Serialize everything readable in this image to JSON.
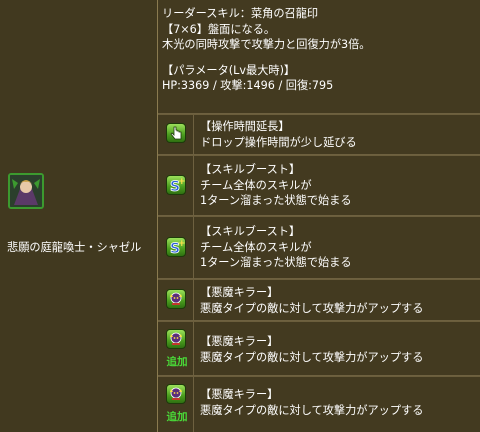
{
  "monster": {
    "name": "悲願の庭龍喚士・シャゼル",
    "portrait_icon": "monster-portrait"
  },
  "leader_skill": {
    "lines": [
      "リーダースキル：菜角の召龍印",
      "【7×6】盤面になる。",
      "木光の同時攻撃で攻撃力と回復力が3倍。"
    ],
    "params_title": "【パラメータ(Lv最大時)】",
    "params": "HP:3369 / 攻撃:1496 / 回復:795"
  },
  "awakenings": [
    {
      "icon": "hand-cursor-icon",
      "title": "【操作時間延長】",
      "desc": [
        "ドロップ操作時間が少し延びる"
      ],
      "badge": ""
    },
    {
      "icon": "skill-boost-icon",
      "title": "【スキルブースト】",
      "desc": [
        "チーム全体のスキルが",
        "1ターン溜まった状態で始まる"
      ],
      "badge": ""
    },
    {
      "icon": "skill-boost-icon",
      "title": "【スキルブースト】",
      "desc": [
        "チーム全体のスキルが",
        "1ターン溜まった状態で始まる"
      ],
      "badge": ""
    },
    {
      "icon": "devil-killer-icon",
      "title": "【悪魔キラー】",
      "desc": [
        "悪魔タイプの敵に対して攻撃力がアップする"
      ],
      "badge": ""
    },
    {
      "icon": "devil-killer-icon",
      "title": "【悪魔キラー】",
      "desc": [
        "悪魔タイプの敵に対して攻撃力がアップする"
      ],
      "badge": "追加"
    },
    {
      "icon": "devil-killer-icon",
      "title": "【悪魔キラー】",
      "desc": [
        "悪魔タイプの敵に対して攻撃力がアップする"
      ],
      "badge": "追加"
    }
  ],
  "colors": {
    "background": "#6b5e3c",
    "cell": "#433a20",
    "text": "#ffffff",
    "badge": "#49d838",
    "icon_green": "#4a9d1e"
  }
}
